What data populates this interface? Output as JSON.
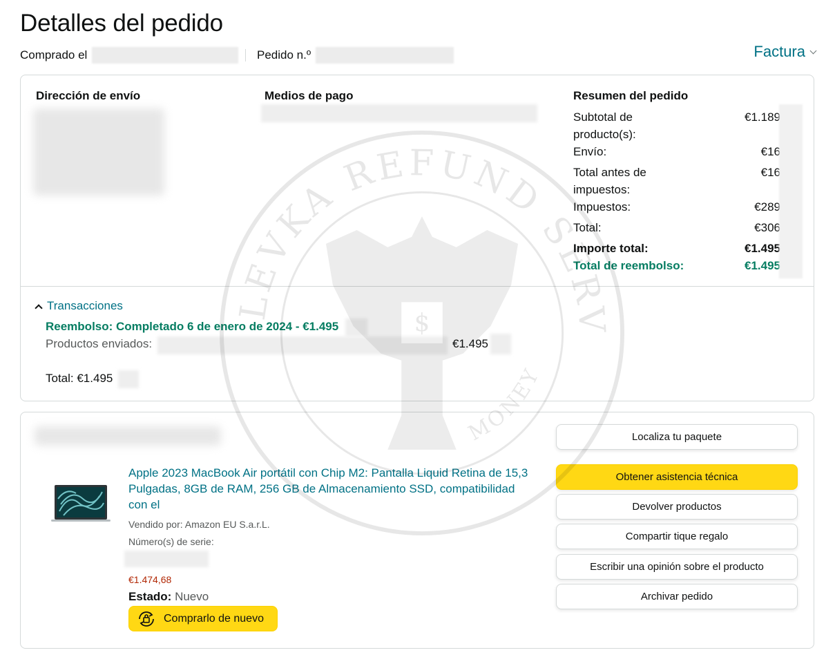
{
  "page": {
    "title": "Detalles del pedido",
    "purchased_label": "Comprado el",
    "order_number_label": "Pedido n.º",
    "invoice_label": "Factura"
  },
  "shipping": {
    "title": "Dirección de envío"
  },
  "payment": {
    "title": "Medios de pago"
  },
  "summary": {
    "title": "Resumen del pedido",
    "rows": [
      {
        "label": "Subtotal de producto(s):",
        "value": "€1.189"
      },
      {
        "label": "Envío:",
        "value": "€16"
      },
      {
        "label": "Total antes de impuestos:",
        "value": "€16"
      },
      {
        "label": "Impuestos:",
        "value": "€289"
      },
      {
        "label": "Total:",
        "value": "€306"
      }
    ],
    "grand_total_label": "Importe total:",
    "grand_total_value": "€1.495",
    "refund_total_label": "Total de reembolso:",
    "refund_total_value": "€1.495"
  },
  "transactions": {
    "toggle_label": "Transacciones",
    "refund_line": "Reembolso: Completado 6 de enero de 2024 - €1.495",
    "products_label": "Productos enviados:",
    "products_value": "€1.495",
    "total_line": "Total: €1.495"
  },
  "product": {
    "title": "Apple 2023 MacBook Air portátil con Chip M2: Pantalla Liquid Retina de 15,3 Pulgadas, 8GB de RAM, 256 GB de Almacenamiento SSD, compatibilidad con el",
    "seller": "Vendido por: Amazon EU S.a.r.L.",
    "serial_label": "Número(s) de serie:",
    "price": "€1.474,68",
    "status_label": "Estado:",
    "status_value": "Nuevo",
    "buy_again_label": "Comprarlo de nuevo"
  },
  "actions": [
    {
      "label": "Localiza tu paquete"
    },
    {
      "label": "Obtener asistencia técnica"
    },
    {
      "label": "Devolver productos"
    },
    {
      "label": "Compartir tique regalo"
    },
    {
      "label": "Escribir una opinión sobre el producto"
    },
    {
      "label": "Archivar pedido"
    }
  ],
  "watermark": {
    "text_top": "RUBLEVKA REFUND SERVICE",
    "text_bottom": "MONEY"
  },
  "colors": {
    "link": "#007185",
    "green": "#067d62",
    "price": "#b12704",
    "button_yellow": "#ffd814"
  }
}
